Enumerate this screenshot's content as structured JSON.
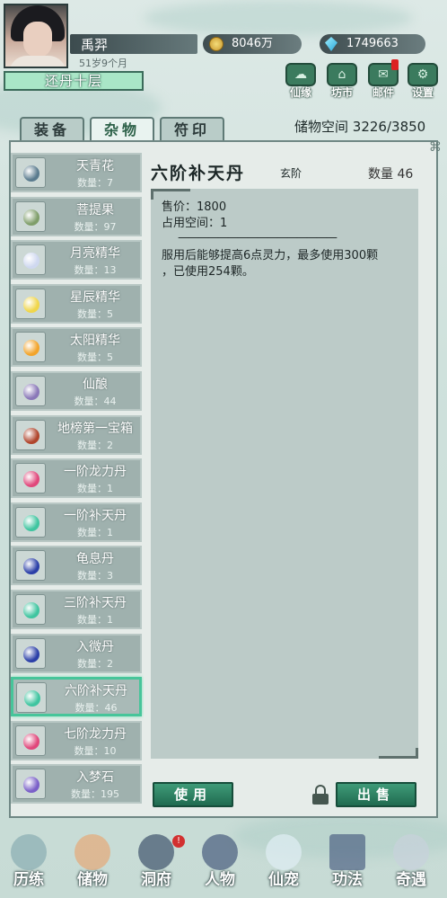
{
  "player": {
    "name": "禹羿",
    "age": "51岁9个月",
    "realm": "还丹十层"
  },
  "currency": {
    "coins": "8046万",
    "gems": "1749663"
  },
  "top_buttons": [
    {
      "label": "仙缘",
      "icon": "fate-icon"
    },
    {
      "label": "坊市",
      "icon": "market-icon"
    },
    {
      "label": "邮件",
      "icon": "mail-icon"
    },
    {
      "label": "设置",
      "icon": "settings-icon"
    }
  ],
  "storage": {
    "label": "储物空间",
    "value": "3226/3850"
  },
  "tabs": [
    "装备",
    "杂物",
    "符印"
  ],
  "items": [
    {
      "name": "天青花",
      "qty": "数量：7",
      "icon": "flower-icon",
      "color": "#5a7b8e"
    },
    {
      "name": "菩提果",
      "qty": "数量：97",
      "icon": "fruit-icon",
      "color": "#7f9e6a"
    },
    {
      "name": "月亮精华",
      "qty": "数量：13",
      "icon": "moon-icon",
      "color": "#cfd8f0"
    },
    {
      "name": "星辰精华",
      "qty": "数量：5",
      "icon": "star-icon",
      "color": "#f0d64a"
    },
    {
      "name": "太阳精华",
      "qty": "数量：5",
      "icon": "sun-icon",
      "color": "#f2a42a"
    },
    {
      "name": "仙酿",
      "qty": "数量：44",
      "icon": "wine-icon",
      "color": "#8a78b8"
    },
    {
      "name": "地榜第一宝箱",
      "qty": "数量：2",
      "icon": "chest-icon",
      "color": "#b0452c"
    },
    {
      "name": "一阶龙力丹",
      "qty": "数量：1",
      "icon": "pill-icon",
      "color": "#e0477b"
    },
    {
      "name": "一阶补天丹",
      "qty": "数量：1",
      "icon": "pill-icon",
      "color": "#3fc5a0"
    },
    {
      "name": "龟息丹",
      "qty": "数量：3",
      "icon": "pill-icon",
      "color": "#2b3fa8"
    },
    {
      "name": "三阶补天丹",
      "qty": "数量：1",
      "icon": "pill-icon",
      "color": "#3fc5a0"
    },
    {
      "name": "入微丹",
      "qty": "数量：2",
      "icon": "pill-icon",
      "color": "#2b3fa8"
    },
    {
      "name": "六阶补天丹",
      "qty": "数量：46",
      "icon": "pill-icon",
      "color": "#3fc5a0"
    },
    {
      "name": "七阶龙力丹",
      "qty": "数量：10",
      "icon": "pill-icon",
      "color": "#e0477b"
    },
    {
      "name": "入梦石",
      "qty": "数量：195",
      "icon": "dream-stone-icon",
      "color": "#7a5fc8"
    }
  ],
  "detail": {
    "title": "六阶补天丹",
    "grade": "玄阶",
    "qty": "数量 46",
    "price": "售价：1800",
    "space": "占用空间：1",
    "divider": "————————————————",
    "effect_line1": "服用后能够提高6点灵力，最多使用300颗",
    "effect_line2": "，已使用254颗。"
  },
  "actions": {
    "use": "使用",
    "sell": "出售"
  },
  "bottom_nav": [
    "历练",
    "储物",
    "洞府",
    "人物",
    "仙宠",
    "功法",
    "奇遇"
  ],
  "nav_badge": "!"
}
